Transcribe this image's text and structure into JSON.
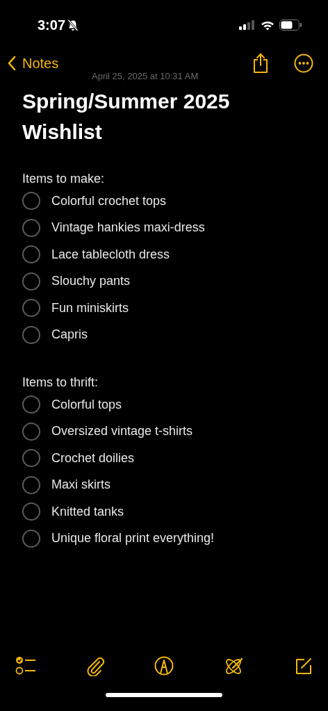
{
  "status_bar": {
    "time": "3:07",
    "silent": true
  },
  "nav": {
    "back": "Notes"
  },
  "note": {
    "date": "April 25, 2025 at 10:31 AM",
    "title": "Spring/Summer 2025 Wishlist",
    "sections": [
      {
        "heading": "Items to make:",
        "items": [
          {
            "text": "Colorful crochet tops",
            "checked": false
          },
          {
            "text": "Vintage hankies maxi-dress",
            "checked": false
          },
          {
            "text": "Lace tablecloth dress",
            "checked": false
          },
          {
            "text": "Slouchy pants",
            "checked": false
          },
          {
            "text": "Fun miniskirts",
            "checked": false
          },
          {
            "text": "Capris",
            "checked": false
          }
        ]
      },
      {
        "heading": "Items to thrift:",
        "items": [
          {
            "text": "Colorful tops",
            "checked": false
          },
          {
            "text": "Oversized vintage t-shirts",
            "checked": false
          },
          {
            "text": "Crochet doilies",
            "checked": false
          },
          {
            "text": "Maxi skirts",
            "checked": false
          },
          {
            "text": "Knitted tanks",
            "checked": false
          },
          {
            "text": "Unique floral print everything!",
            "checked": false
          }
        ]
      }
    ]
  }
}
